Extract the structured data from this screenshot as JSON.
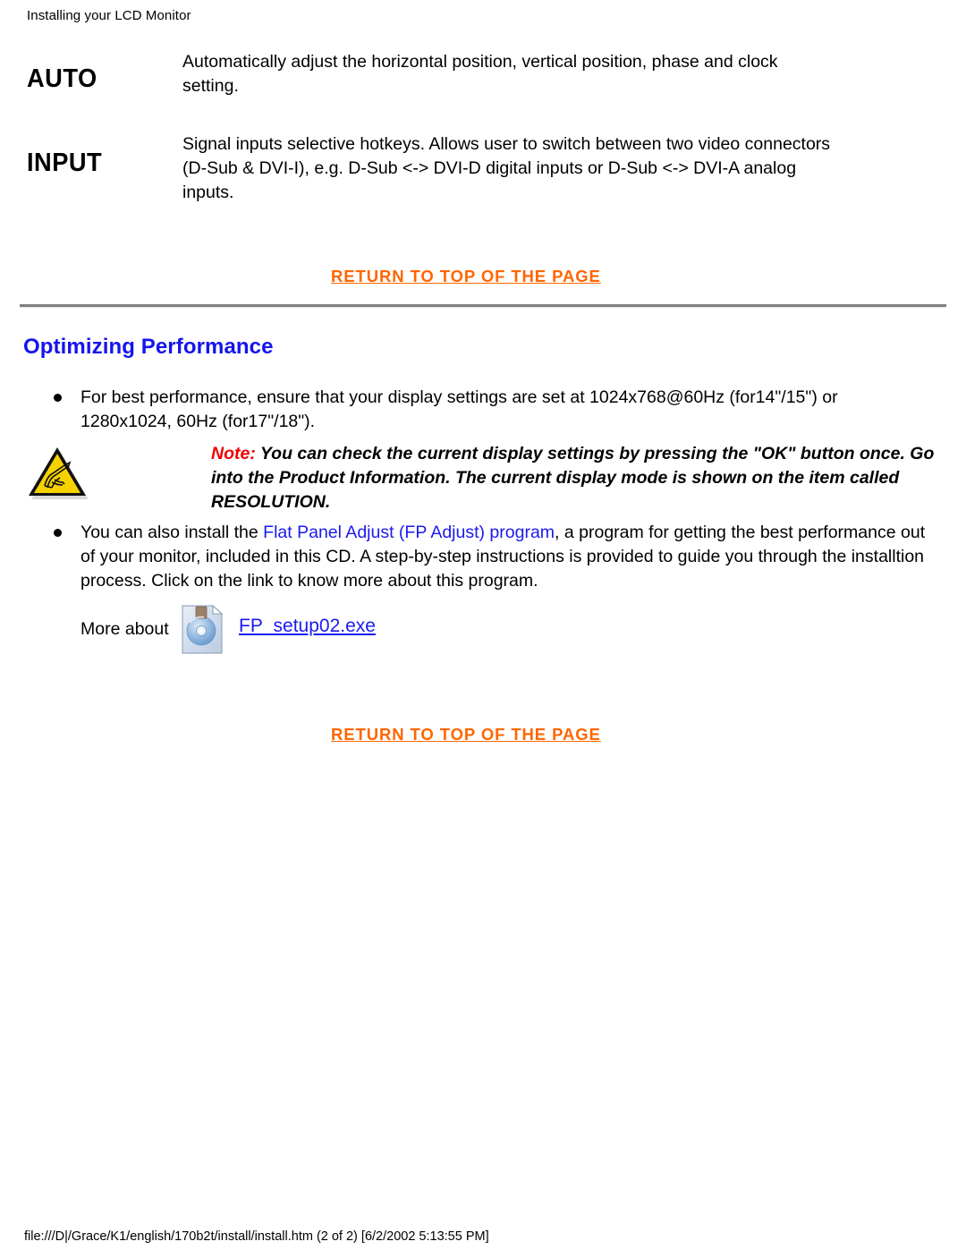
{
  "header": {
    "title": "Installing your LCD Monitor"
  },
  "key_rows": [
    {
      "label": "AUTO",
      "description": "Automatically adjust the horizontal position, vertical position, phase and clock setting."
    },
    {
      "label": "INPUT",
      "description": "Signal inputs selective hotkeys. Allows user to switch between two video connectors (D-Sub & DVI-I), e.g. D-Sub <-> DVI-D digital inputs or D-Sub <-> DVI-A analog inputs."
    }
  ],
  "links": {
    "return_to_top": "RETURN TO TOP OF THE PAGE",
    "fp_adjust_program": "Flat Panel Adjust (FP Adjust) program",
    "fp_setup_exe": "FP_setup02.exe"
  },
  "section": {
    "title": "Optimizing Performance"
  },
  "bullets": [
    {
      "before": "For best performance, ensure that your display settings are set at 1024x768@60Hz (for14\"/15\") or 1280x1024, 60Hz (for17\"/18\")."
    },
    {
      "before": "You can also install the ",
      "link": "Flat Panel Adjust (FP Adjust) program",
      "after": ", a program for getting the best performance out of your monitor, included in this CD. A step-by-step instructions is provided to guide you through the installtion process. Click on the link to know more about this program."
    }
  ],
  "note": {
    "keyword": "Note:",
    "body": " You can check the current display settings by pressing the \"OK\" button once. Go into the Product Information. The current display mode is shown on the item called RESOLUTION.",
    "icon": "warning-triangle-hand-icon"
  },
  "more_about": {
    "label": "More about",
    "icon": "cd-disc-file-icon",
    "link": "FP_setup02.exe"
  },
  "footer": {
    "path": "file:///D|/Grace/K1/english/170b2t/install/install.htm (2 of 2) [6/2/2002 5:13:55 PM]"
  },
  "colors": {
    "link_orange": "#ff6600",
    "link_blue": "#1a1aee",
    "heading_blue": "#1414ee",
    "note_red": "#ee0000",
    "rule_gray": "#808080"
  }
}
